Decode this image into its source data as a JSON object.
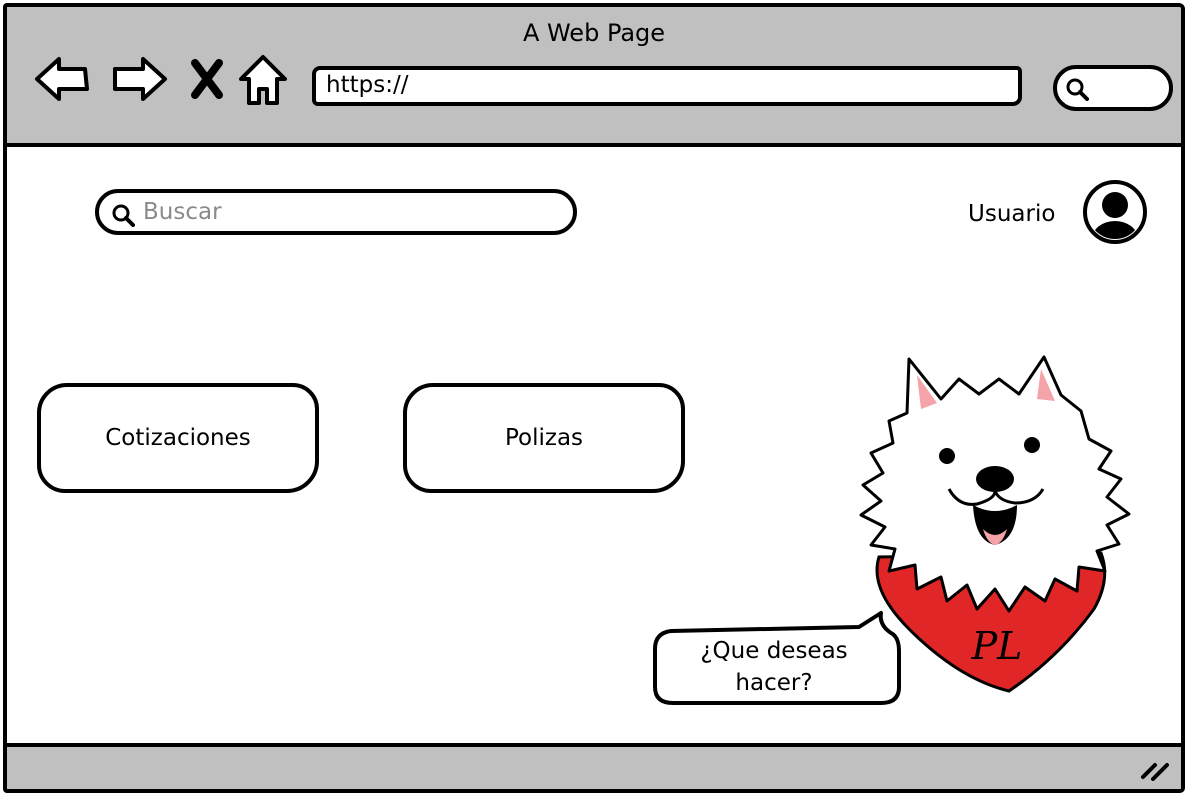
{
  "browser": {
    "title": "A Web Page",
    "url": "https://"
  },
  "header": {
    "search_placeholder": "Buscar",
    "user_label": "Usuario"
  },
  "main": {
    "tiles": [
      {
        "label": "Cotizaciones"
      },
      {
        "label": "Polizas"
      }
    ]
  },
  "assistant": {
    "bubble_line1": "¿Que deseas",
    "bubble_line2": "hacer?",
    "logo_letters": "PL"
  },
  "colors": {
    "chrome": "#c0c0c0",
    "bandana_red": "#e02626",
    "ear_pink": "#f4a3a8"
  }
}
